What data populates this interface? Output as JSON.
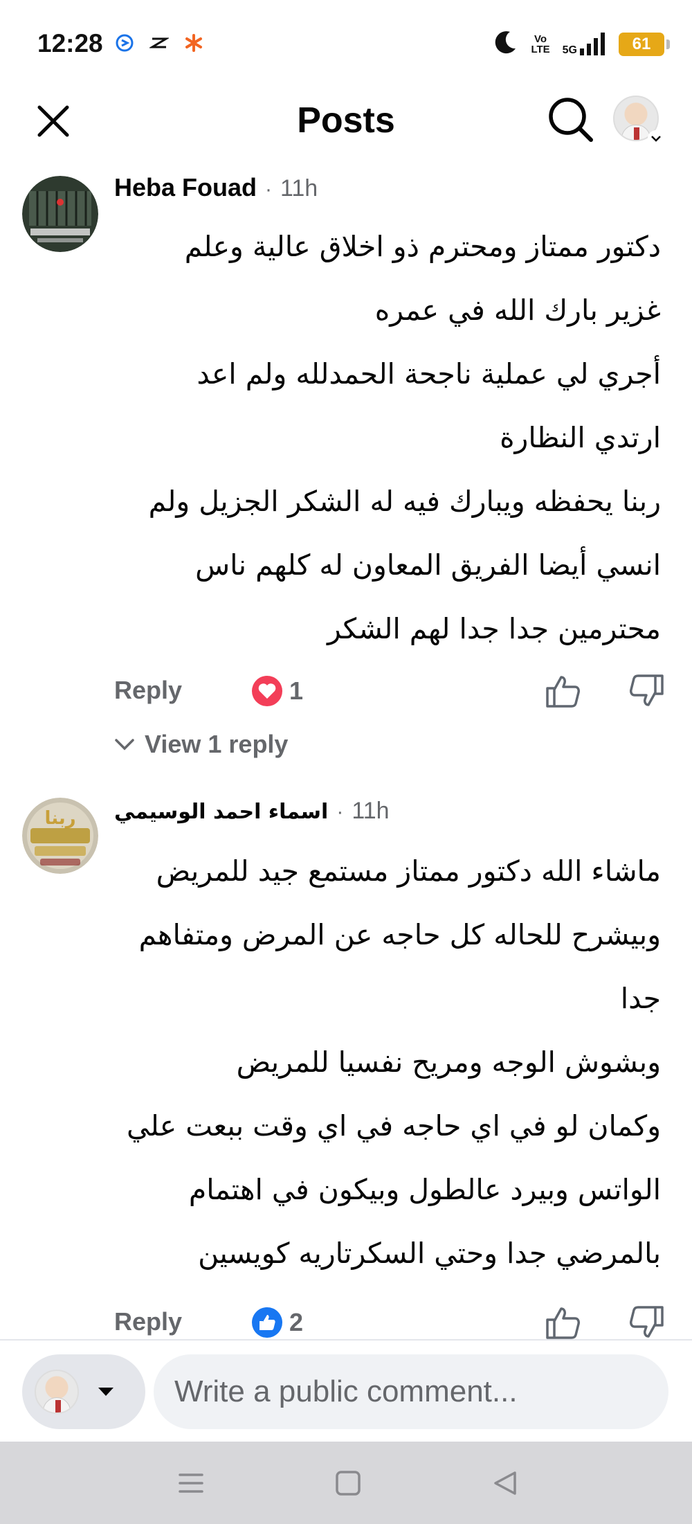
{
  "status_bar": {
    "time": "12:28",
    "volte_line1": "Vo",
    "volte_line2": "LTE",
    "network": "5G",
    "battery": "61"
  },
  "header": {
    "title": "Posts"
  },
  "comments": [
    {
      "author": "Heba Fouad",
      "time": "11h",
      "lines": [
        "دكتور ممتاز ومحترم ذو اخلاق عالية وعلم",
        "غزير بارك الله في عمره",
        "أجري لي عملية ناجحة الحمدلله ولم اعد",
        "ارتدي النظارة",
        "ربنا يحفظه ويبارك فيه له الشكر الجزيل ولم",
        "انسي أيضا الفريق المعاون له  كلهم ناس",
        "محترمين جدا جدا لهم الشكر"
      ],
      "reply_label": "Reply",
      "reaction_count": "1",
      "reaction_type": "heart",
      "view_replies": "View 1 reply"
    },
    {
      "author": "اسماء احمد الوسيمي",
      "time": "11h",
      "lines": [
        "ماشاء الله دكتور ممتاز مستمع جيد للمريض",
        "وبيشرح للحاله كل حاجه عن المرض ومتفاهم",
        "جدا",
        "وبشوش الوجه ومريح نفسيا للمريض",
        "وكمان لو في اي حاجه في اي وقت ببعت علي",
        "الواتس وبيرد عالطول وبيكون في اهتمام",
        "بالمرضي جدا وحتي السكرتاريه كويسين"
      ],
      "reply_label": "Reply",
      "reaction_count": "2",
      "reaction_type": "like"
    }
  ],
  "composer": {
    "placeholder": "Write a public comment..."
  },
  "colors": {
    "secondary_text": "#65676b",
    "love_red": "#f33e58",
    "like_blue": "#1877f2",
    "input_bg": "#f0f2f5",
    "nav_bg": "#d7d7da",
    "battery": "#e6a817"
  }
}
